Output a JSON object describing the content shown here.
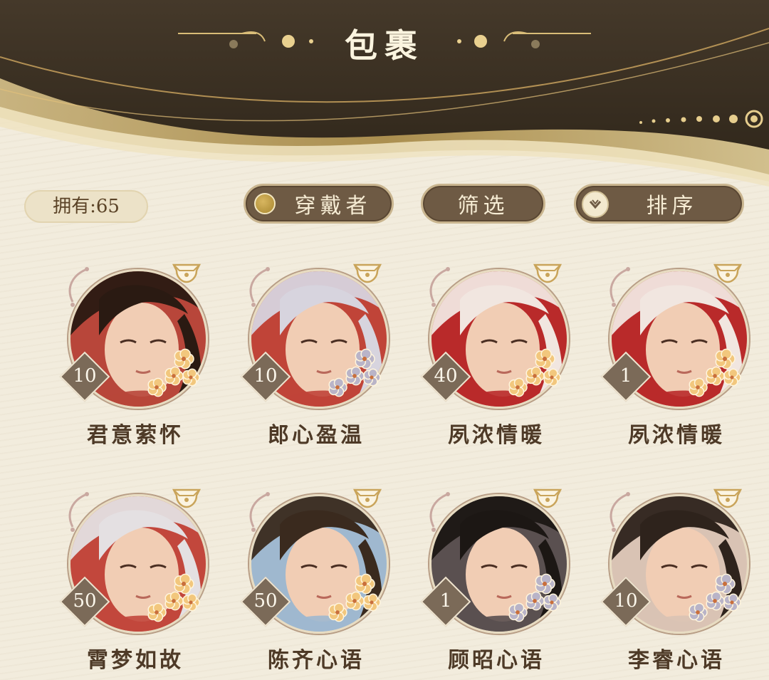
{
  "header": {
    "title": "包裹"
  },
  "toolbar": {
    "owned_label": "拥有:65",
    "wearer_label": "穿戴者",
    "filter_label": "筛选",
    "sort_label": "排序"
  },
  "colors": {
    "header_dark": "#3b301f",
    "gold": "#c9a45a",
    "button_fill": "#6e5a44",
    "page_bg": "#f2ecdd",
    "level_badge": "#7b6a58"
  },
  "items": [
    {
      "name": "君意萦怀",
      "level": "10",
      "hair": "#2a1a12",
      "bg": "#b8463a",
      "flower": "gold-flower-icon"
    },
    {
      "name": "郎心盈温",
      "level": "10",
      "hair": "#d7d4de",
      "bg": "#c04438",
      "flower": "silver-flower-icon"
    },
    {
      "name": "夙浓情暖",
      "level": "40",
      "hair": "#f1e6e0",
      "bg": "#b92a2a",
      "flower": "gold-flower-icon"
    },
    {
      "name": "夙浓情暖",
      "level": "1",
      "hair": "#f1e6e0",
      "bg": "#b92a2a",
      "flower": "gold-flower-icon"
    },
    {
      "name": "霄梦如故",
      "level": "50",
      "hair": "#e4e0e2",
      "bg": "#c2473c",
      "flower": "gold-flower-icon"
    },
    {
      "name": "陈齐心语",
      "level": "50",
      "hair": "#3a2a1e",
      "bg": "#9fb8cf",
      "flower": "gold-flower-icon"
    },
    {
      "name": "顾昭心语",
      "level": "1",
      "hair": "#1c1714",
      "bg": "#5a5050",
      "flower": "silver-flower-icon"
    },
    {
      "name": "李睿心语",
      "level": "10",
      "hair": "#2e231c",
      "bg": "#d9c3b4",
      "flower": "silver-flower-icon"
    }
  ]
}
